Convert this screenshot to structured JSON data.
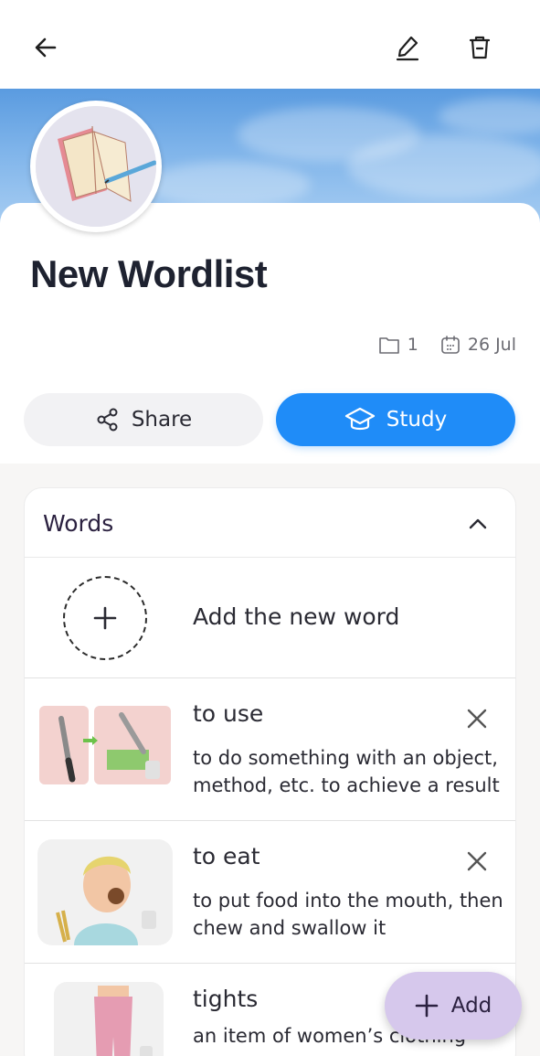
{
  "header": {
    "back_icon": "arrow-left-icon",
    "edit_icon": "pencil-icon",
    "delete_icon": "trash-icon"
  },
  "wordlist": {
    "title": "New Wordlist",
    "folder_count": "1",
    "date": "26 Jul"
  },
  "actions": {
    "share_label": "Share",
    "study_label": "Study"
  },
  "words_section": {
    "title": "Words",
    "add_label": "Add the new word",
    "items": [
      {
        "term": "to use",
        "definition": "to do something with an object, method, etc. to achieve a result"
      },
      {
        "term": "to eat",
        "definition": "to put food into the mouth, then chew and swallow it"
      },
      {
        "term": "tights",
        "definition": "an item of women’s clothing"
      }
    ]
  },
  "fab": {
    "label": "Add"
  },
  "colors": {
    "accent": "#1f8cf8",
    "fab": "#d6c8ec",
    "title": "#1e2230"
  }
}
